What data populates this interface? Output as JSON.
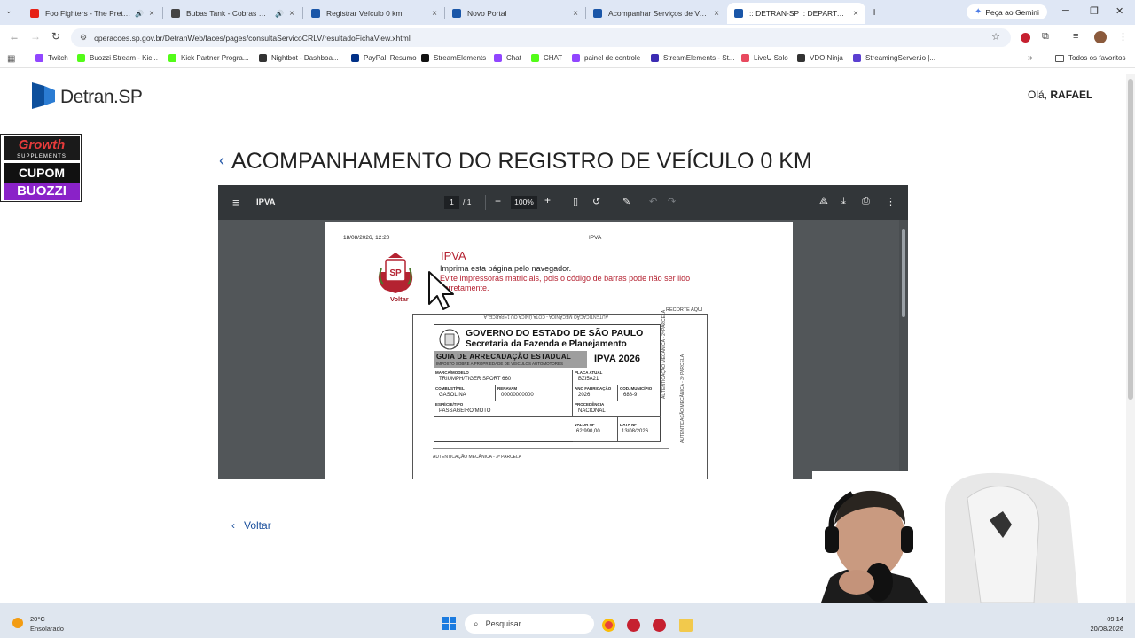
{
  "browser": {
    "tabs": [
      {
        "title": "Foo Fighters - The Pretender",
        "favicon_color": "#e62117",
        "audio": true
      },
      {
        "title": "Bubas Tank - Cobras — Baixo",
        "favicon_color": "#444444",
        "audio": true
      },
      {
        "title": "Registrar Veículo 0 km",
        "favicon_color": "#1a56a8",
        "audio": false
      },
      {
        "title": "Novo Portal",
        "favicon_color": "#1a56a8",
        "audio": false
      },
      {
        "title": "Acompanhar Serviços de Veículo",
        "favicon_color": "#1a56a8",
        "audio": false
      },
      {
        "title": ":: DETRAN-SP :: DEPARTAMENTO",
        "favicon_color": "#1a56a8",
        "audio": false,
        "active": true
      }
    ],
    "new_tab_label": "+",
    "gemini_label": "Peça ao Gemini",
    "url": "operacoes.sp.gov.br/DetranWeb/faces/pages/consultaServicoCRLV/resultadoFichaView.xhtml",
    "bookmarks": [
      {
        "label": "Twitch",
        "color": "#9146ff"
      },
      {
        "label": "Buozzi Stream - Kic...",
        "color": "#53fc18"
      },
      {
        "label": "Kick Partner Progra...",
        "color": "#53fc18"
      },
      {
        "label": "Nightbot - Dashboa...",
        "color": "#333333"
      },
      {
        "label": "PayPal: Resumo",
        "color": "#003087"
      },
      {
        "label": "StreamElements",
        "color": "#111111"
      },
      {
        "label": "Chat",
        "color": "#9146ff"
      },
      {
        "label": "CHAT",
        "color": "#53fc18"
      },
      {
        "label": "painel de controle",
        "color": "#9146ff"
      },
      {
        "label": "StreamElements - St...",
        "color": "#3b2bb3"
      },
      {
        "label": "LiveU Solo",
        "color": "#e84a5f"
      },
      {
        "label": "VDO.Ninja",
        "color": "#333333"
      },
      {
        "label": "StreamingServer.io |...",
        "color": "#5b3fd1"
      }
    ],
    "favorites_label": "Todos os favoritos"
  },
  "site": {
    "logo": "Detran.SP",
    "greeting_prefix": "Olá,",
    "user_name": "RAFAEL",
    "page_title": "ACOMPANHAMENTO DO REGISTRO DE VEÍCULO 0 KM",
    "back_label": "Voltar",
    "ad": {
      "line1": "Growth",
      "line2": "SUPPLEMENTS",
      "line3": "CUPOM",
      "line4": "BUOZZI"
    }
  },
  "pdf": {
    "title": "IPVA",
    "page_current": "1",
    "page_total": "/ 1",
    "zoom": "100%",
    "doc": {
      "timestamp": "18/08/2026, 12:20",
      "header": "IPVA",
      "voltar": "Voltar",
      "heading": "IPVA",
      "print_instruction": "Imprima esta página pelo navegador.",
      "warning": "Evite impressoras matriciais, pois o código de barras pode não ser lido corretamente.",
      "recorte": "RECORTE AQUI",
      "top_strip": "AUTENTICAÇÃO MECÂNICA - COTA ÚNICA OU 1ª PARCELA",
      "gov_line1": "GOVERNO DO ESTADO DE SÃO PAULO",
      "gov_line2": "Secretaria da Fazenda e Planejamento",
      "guia_title": "GUIA DE ARRECADAÇÃO ESTADUAL",
      "guia_subtitle": "IMPOSTO SOBRE A PROPRIEDADE DE VEÍCULOS AUTOMOTORES",
      "ipva_year": "IPVA 2026",
      "side_auth_1": "AUTENTICAÇÃO MECÂNICA - 2ª PARCELA",
      "side_auth_2": "AUTENTICAÇÃO MECÂNICA - 3ª PARCELA",
      "fields": {
        "marca_label": "MARCA/MODELO",
        "marca": "TRIUMPH/TIGER SPORT 660",
        "placa_label": "PLACA ATUAL",
        "placa": "BZI5A21",
        "combustivel_label": "COMBUSTÍVEL",
        "combustivel": "GASOLINA",
        "renavam_label": "RENAVAM",
        "renavam": "00000000000",
        "ano_label": "ANO FABRICAÇÃO",
        "ano": "2026",
        "municipio_label": "COD. MUNICÍPIO",
        "municipio": "688-9",
        "especie_label": "ESPÉCIE/TIPO",
        "especie": "PASSAGEIRO/MOTO",
        "procedencia_label": "PROCEDÊNCIA",
        "procedencia": "NACIONAL",
        "valor_label": "VALOR NF",
        "valor": "62.990,00",
        "data_label": "DATA NF",
        "data": "13/08/2026"
      },
      "auth_bottom": "AUTENTICAÇÃO MECÂNICA - 3ª PARCELA"
    }
  },
  "taskbar": {
    "temperature": "20°C",
    "condition": "Ensolarado",
    "search_placeholder": "Pesquisar",
    "time": "09:14",
    "date": "20/08/2026"
  },
  "colors": {
    "brand_blue": "#0d4f9c",
    "pdf_toolbar": "#323639",
    "pdf_bg": "#525659",
    "warning_red": "#b42231"
  }
}
